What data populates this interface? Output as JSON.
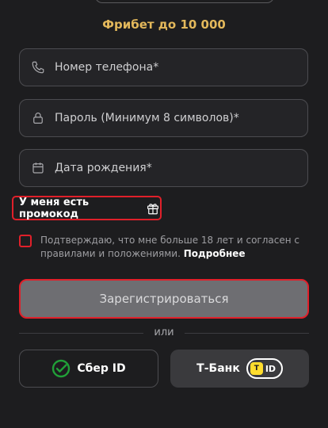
{
  "bonus": {
    "freebet_label": "Фрибет до 10 000"
  },
  "form": {
    "phone_placeholder": "Номер телефона*",
    "password_placeholder": "Пароль (Минимум 8 символов)*",
    "birthdate_placeholder": "Дата рождения*",
    "promo_label": "У меня есть промокод",
    "consent_text": "Подтверждаю, что мне больше 18 лет и согласен с правилами и положениями.",
    "consent_link": "Подробнее",
    "register_label": "Зарегистрироваться",
    "divider_text": "или"
  },
  "social": {
    "sber_label": "Сбер ID",
    "tbank_label": "Т-Банк",
    "tbank_badge_text": "ID",
    "tbank_logo_glyph": "Т"
  },
  "colors": {
    "accent_gold": "#e3b85b",
    "highlight_red": "#e0202a",
    "sber_green": "#21a038",
    "tbank_yellow": "#ffdd2d",
    "background": "#1d1d1f"
  },
  "icons": [
    "phone-icon",
    "lock-icon",
    "calendar-icon",
    "gift-icon",
    "sber-logo-icon",
    "tbank-shield-icon"
  ]
}
